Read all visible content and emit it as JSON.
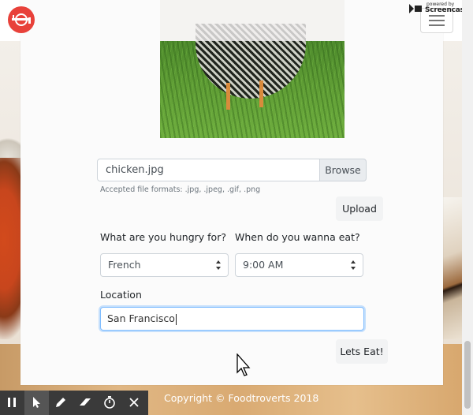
{
  "extension_badge": {
    "powered_by": "powered by",
    "name": "Screencastify"
  },
  "navbar": {
    "logo_icon": "fork-knife-logo-icon",
    "menu_icon": "hamburger-menu-icon"
  },
  "upload": {
    "file_name": "chicken.jpg",
    "browse_label": "Browse",
    "hint": "Accepted file formats: .jpg, .jpeg, .gif, .png",
    "upload_label": "Upload"
  },
  "form": {
    "cuisine_label": "What are you hungry for?",
    "cuisine_value": "French",
    "time_label": "When do you wanna eat?",
    "time_value": "9:00 AM",
    "location_label": "Location",
    "location_value": "San Francisco",
    "submit_label": "Lets Eat!"
  },
  "footer": {
    "copyright": "Copyright © Foodtroverts 2018"
  },
  "recorder_toolbar": {
    "tools": [
      "pause-icon",
      "pointer-icon",
      "pen-icon",
      "eraser-icon",
      "timer-icon",
      "close-icon"
    ]
  },
  "colors": {
    "logo": "#e8413a",
    "focus_border": "#80bdff",
    "toolbar_bg": "#3a3a3a"
  }
}
